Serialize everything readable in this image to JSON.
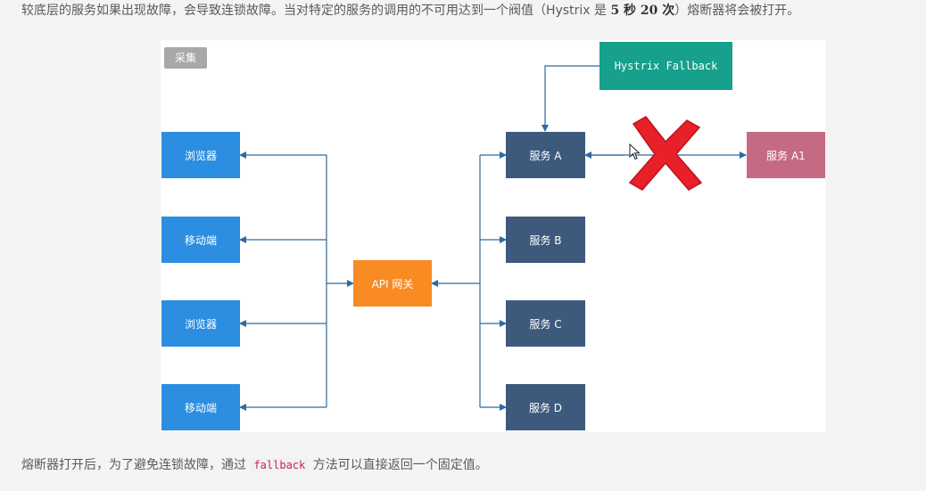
{
  "text": {
    "top_part1": "较底层的服务如果出现故障，会导致连锁故障。当对特定的服务的调用的不可用达到一个阀值（Hystrix 是 ",
    "top_bold": "5 秒 20 次",
    "top_part2": "）熔断器将会被打开。",
    "bottom_part1": "熔断器打开后，为了避免连锁故障，通过 ",
    "bottom_code": "fallback",
    "bottom_part2": " 方法可以直接返回一个固定值。"
  },
  "toolbar": {
    "collect_label": "采集"
  },
  "diagram": {
    "clients": [
      "浏览器",
      "移动端",
      "浏览器",
      "移动端"
    ],
    "gateway": "API 网关",
    "services": [
      "服务 A",
      "服务 B",
      "服务 C",
      "服务 D"
    ],
    "fallback": "Hystrix Fallback",
    "downstream": "服务 A1"
  },
  "colors": {
    "client": "#2b8ee0",
    "service": "#3d5a7c",
    "gateway": "#f88b22",
    "fallback": "#17a08b",
    "downstream": "#c56a83",
    "edge": "#2d6a9f",
    "cross": "#e8202a"
  }
}
